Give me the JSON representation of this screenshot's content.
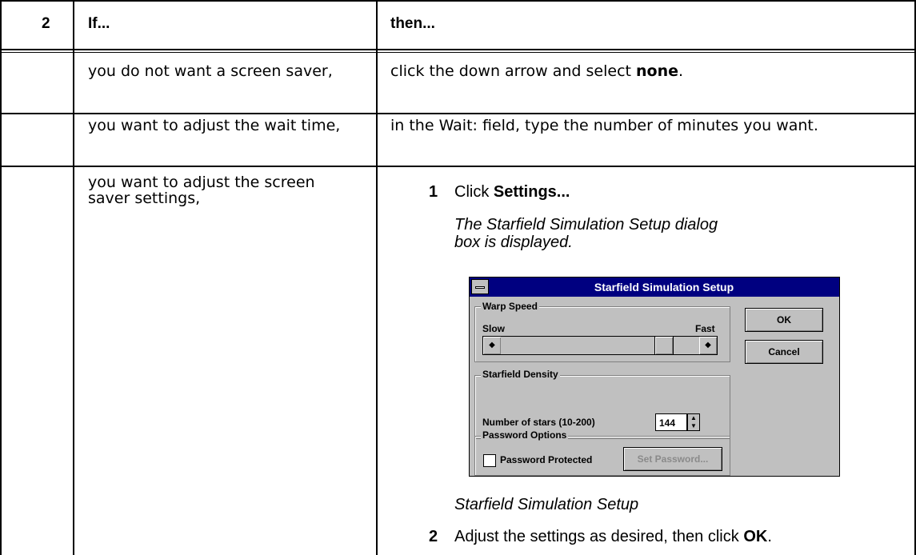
{
  "header": {
    "step": "2",
    "col_if": "If...",
    "col_then": "then..."
  },
  "rows": [
    {
      "if": "you do not want a screen saver,",
      "then_prefix": "click the down arrow and select ",
      "then_bold": "none",
      "then_suffix": "."
    },
    {
      "if": "you want to adjust the wait time,",
      "then": "in the Wait: field, type the number of minutes you want."
    },
    {
      "if": "you want to adjust the screen saver settings,",
      "steps": [
        {
          "num": "1",
          "prefix": "Click ",
          "bold": "Settings...",
          "suffix": ""
        },
        {
          "num": "2",
          "prefix": "Adjust the settings as desired, then click ",
          "bold": "OK",
          "suffix": "."
        }
      ],
      "note": "The Starfield Simulation Setup dialog box is displayed.",
      "caption": "Starfield Simulation Setup"
    }
  ],
  "dialog": {
    "title": "Starfield Simulation Setup",
    "warp_group": "Warp Speed",
    "slow": "Slow",
    "fast": "Fast",
    "density_group": "Starfield Density",
    "num_stars_label": "Number of stars (10-200)",
    "num_stars_value": "144",
    "password_group": "Password Options",
    "password_protected": "Password Protected",
    "set_password": "Set Password...",
    "ok": "OK",
    "cancel": "Cancel"
  }
}
